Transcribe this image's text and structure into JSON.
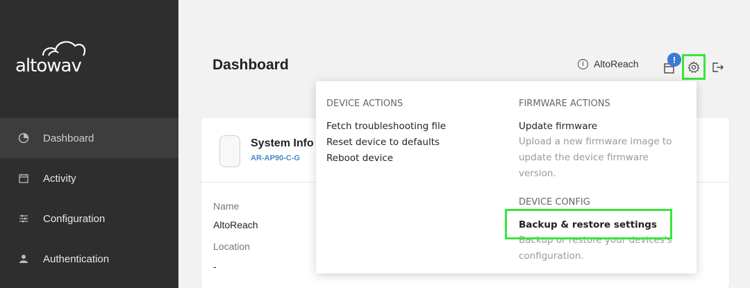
{
  "brand": {
    "logo_text": "altowav"
  },
  "sidebar": {
    "items": [
      {
        "label": "Dashboard",
        "icon": "pie-chart-icon",
        "active": true
      },
      {
        "label": "Activity",
        "icon": "calendar-icon",
        "active": false
      },
      {
        "label": "Configuration",
        "icon": "sliders-icon",
        "active": false
      },
      {
        "label": "Authentication",
        "icon": "user-icon",
        "active": false
      }
    ]
  },
  "header": {
    "title": "Dashboard",
    "device_name": "AltoReach",
    "notification_count": "!",
    "icons": [
      "info-icon",
      "notifications-icon",
      "settings-gear-icon",
      "logout-icon"
    ]
  },
  "card": {
    "title": "System Info",
    "model": "AR-AP90-C-G",
    "fields": [
      {
        "label": "Name",
        "value": "AltoReach"
      },
      {
        "label": "Location",
        "value": "-"
      }
    ]
  },
  "dropdown": {
    "device_actions": {
      "heading": "DEVICE ACTIONS",
      "items": [
        "Fetch troubleshooting file",
        "Reset device to defaults",
        "Reboot device"
      ]
    },
    "firmware_actions": {
      "heading": "FIRMWARE ACTIONS",
      "update_label": "Update firmware",
      "update_desc": "Upload a new firmware image to update the device firmware version."
    },
    "device_config": {
      "heading": "DEVICE CONFIG",
      "backup_label": "Backup & restore settings",
      "backup_desc": "Backup or restore your devices's configuration."
    }
  },
  "colors": {
    "sidebar_bg": "#2e2e2e",
    "accent_blue": "#3a7bd5",
    "highlight": "#39e639"
  }
}
